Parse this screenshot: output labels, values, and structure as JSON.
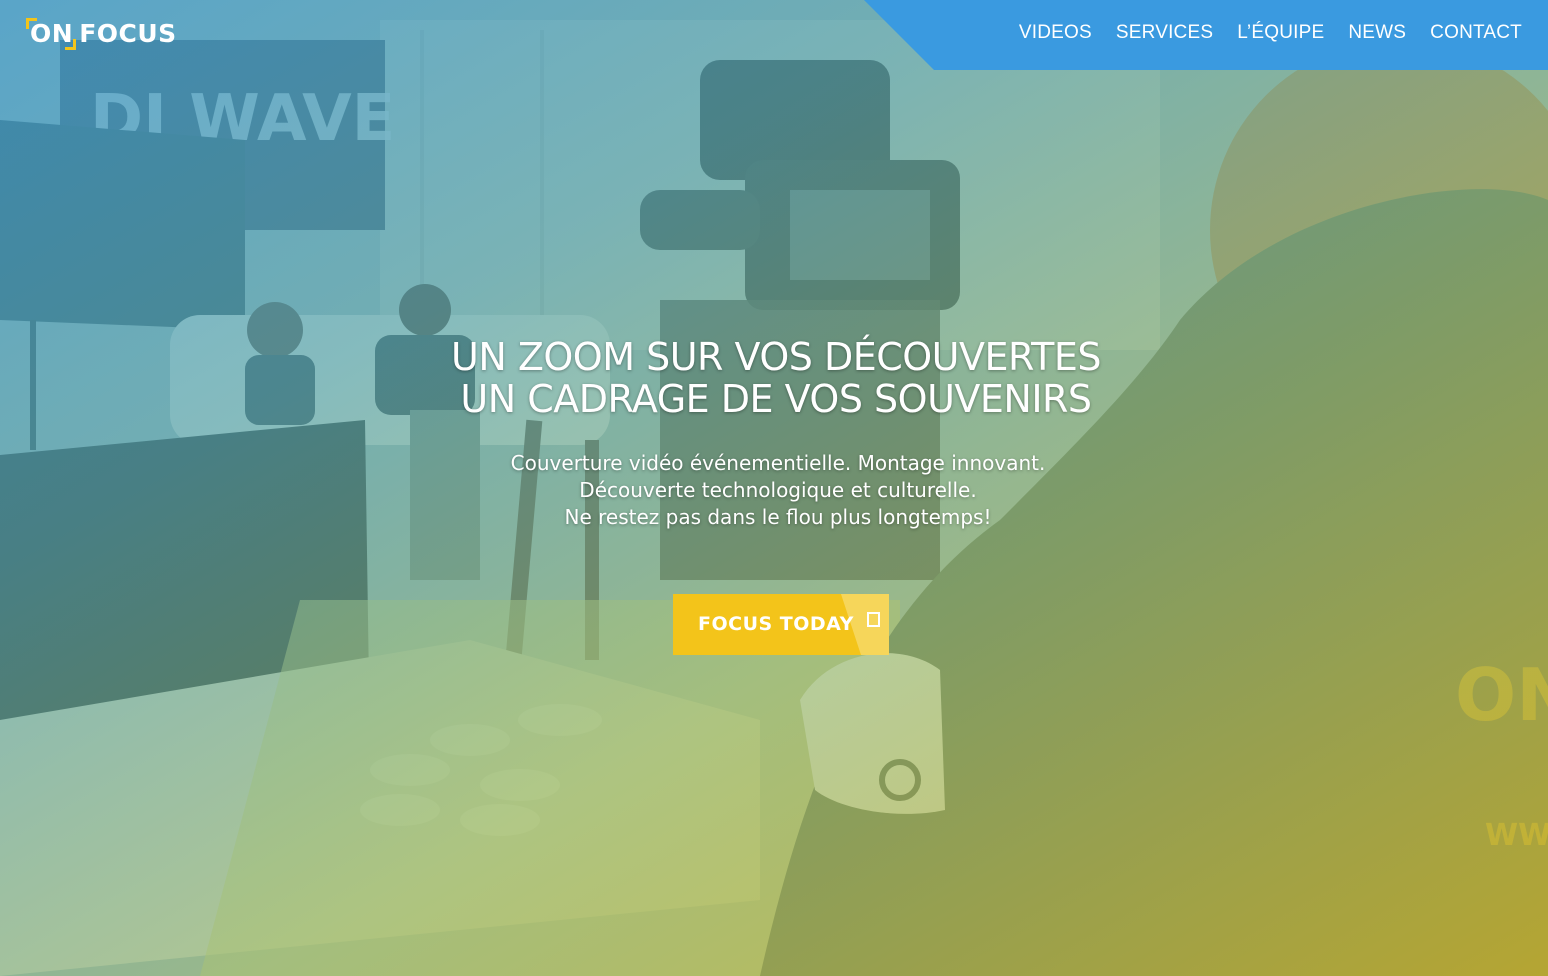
{
  "logo": {
    "part_on": "ON",
    "part_focus": "FOCUS",
    "accent_color": "#f3c41a"
  },
  "nav": {
    "background_color": "#3a9ae0",
    "items": [
      {
        "label": "VIDEOS"
      },
      {
        "label": "SERVICES"
      },
      {
        "label": "L’ÉQUIPE"
      },
      {
        "label": "NEWS"
      },
      {
        "label": "CONTACT"
      }
    ]
  },
  "hero": {
    "headline_lines": [
      "UN ZOOM SUR VOS DÉCOUVERTES",
      "UN CADRAGE DE VOS SOUVENIRS"
    ],
    "sub_lines": [
      "Couverture vidéo événementielle. Montage innovant.",
      "Découverte technologique et culturelle.",
      "Ne restez pas dans le flou plus longtemps!"
    ],
    "background_gradient": [
      "#46a0cd",
      "#cdb428"
    ]
  },
  "cta": {
    "label": "FOCUS TODAY",
    "icon": "square-outline-icon",
    "color": "#f3c41a"
  }
}
